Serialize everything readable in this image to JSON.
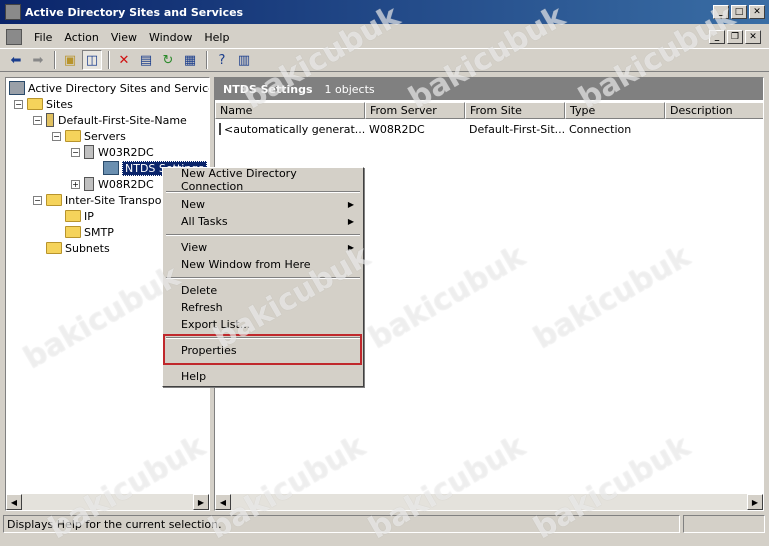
{
  "window": {
    "title": "Active Directory Sites and Services"
  },
  "menubar": {
    "items": [
      "File",
      "Action",
      "View",
      "Window",
      "Help"
    ]
  },
  "tree": {
    "root": "Active Directory Sites and Services [W",
    "sites": "Sites",
    "site": "Default-First-Site-Name",
    "servers": "Servers",
    "server1": "W03R2DC",
    "ntds": "NTDS Settings",
    "server2": "W08R2DC",
    "transports": "Inter-Site Transports",
    "ip": "IP",
    "smtp": "SMTP",
    "subnets": "Subnets"
  },
  "detail": {
    "title": "NTDS Settings",
    "count": "1 objects",
    "columns": [
      "Name",
      "From Server",
      "From Site",
      "Type",
      "Description"
    ],
    "rows": [
      {
        "name": "<automatically generat...",
        "from_server": "W08R2DC",
        "from_site": "Default-First-Sit...",
        "type": "Connection",
        "description": ""
      }
    ]
  },
  "context_menu": {
    "items": [
      {
        "label": "New Active Directory Connection",
        "submenu": false
      },
      {
        "label": "New",
        "submenu": true
      },
      {
        "label": "All Tasks",
        "submenu": true
      },
      {
        "label": "View",
        "submenu": true
      },
      {
        "label": "New Window from Here",
        "submenu": false
      },
      {
        "label": "Delete",
        "submenu": false
      },
      {
        "label": "Refresh",
        "submenu": false
      },
      {
        "label": "Export List...",
        "submenu": false
      },
      {
        "label": "Properties",
        "submenu": false
      },
      {
        "label": "Help",
        "submenu": false
      }
    ],
    "highlight_color": "#c0282c"
  },
  "status": {
    "text": "Displays Help for the current selection."
  },
  "watermark": {
    "text": "bakicubuk"
  },
  "colors": {
    "title_bar": "#0a246a",
    "selection": "#0a246a",
    "face": "#d4d0c8"
  }
}
